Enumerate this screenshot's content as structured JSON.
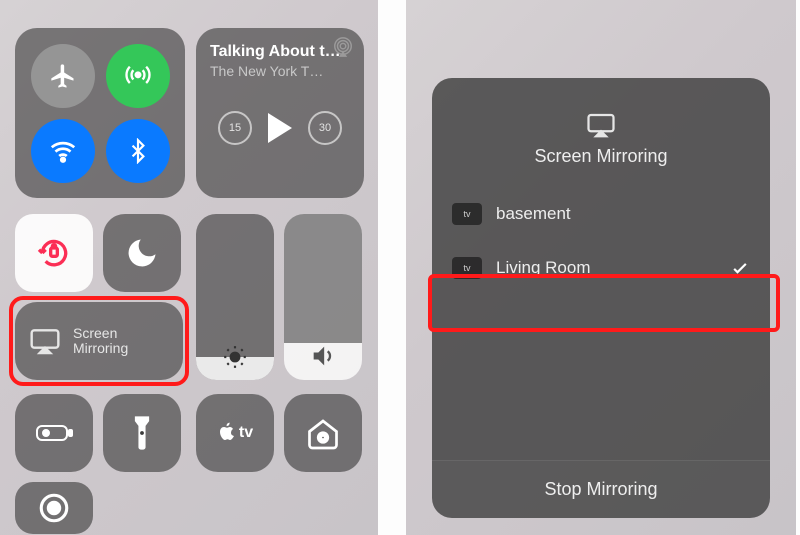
{
  "left": {
    "connectivity": {
      "airplane": "airplane-icon",
      "cellular": "antenna-icon",
      "wifi": "wifi-icon",
      "bluetooth": "bluetooth-icon"
    },
    "now_playing": {
      "title": "Talking About t…",
      "subtitle": "The New York T…",
      "back_label": "15",
      "forward_label": "30"
    },
    "toggles": {
      "rotation_lock": "rotation-lock-icon",
      "do_not_disturb": "moon-icon",
      "brightness": "brightness-icon",
      "volume": "speaker-icon"
    },
    "screen_mirroring": {
      "line1": "Screen",
      "line2": "Mirroring"
    },
    "bottom_row": {
      "low_power": "battery-icon",
      "flashlight": "flashlight-icon",
      "apple_tv": "apple-tv-icon",
      "home": "home-icon",
      "screen_record": "record-icon"
    }
  },
  "right": {
    "title": "Screen Mirroring",
    "devices": [
      {
        "name": "basement",
        "selected": false
      },
      {
        "name": "Living Room",
        "selected": true
      }
    ],
    "stop_label": "Stop Mirroring"
  },
  "colors": {
    "highlight": "#ff1a1a",
    "toggle_green": "#34c759",
    "toggle_blue": "#0a7aff"
  }
}
